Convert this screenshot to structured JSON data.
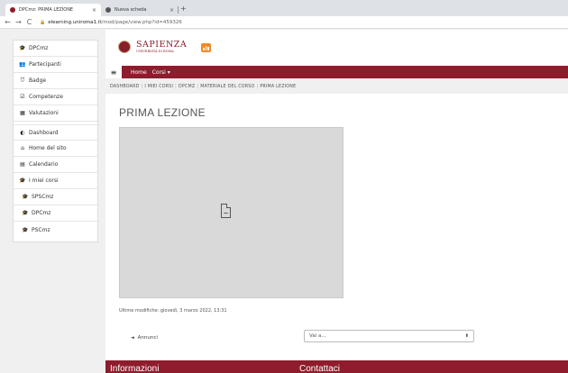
{
  "browser": {
    "tabs": [
      {
        "title": "DPCmz: PRIMA LEZIONE",
        "active": true
      },
      {
        "title": "Nuova scheda",
        "active": false
      }
    ],
    "new_tab": "+",
    "close": "×",
    "nav": {
      "back": "←",
      "forward": "→",
      "reload": "C"
    },
    "url_host": "elearning.uniroma1.it",
    "url_path": "/mod/page/view.php?id=459326"
  },
  "sidebar": {
    "items": [
      {
        "icon": "graduation-cap-icon",
        "glyph": "🎓",
        "label": "DPCmz"
      },
      {
        "icon": "users-icon",
        "glyph": "👥",
        "label": "Partecipanti"
      },
      {
        "icon": "shield-icon",
        "glyph": "⛉",
        "label": "Badge"
      },
      {
        "icon": "check-square-icon",
        "glyph": "☑",
        "label": "Competenze"
      },
      {
        "icon": "table-icon",
        "glyph": "▦",
        "label": "Valutazioni"
      },
      {
        "icon": "dashboard-icon",
        "glyph": "◐",
        "label": "Dashboard"
      },
      {
        "icon": "home-icon",
        "glyph": "⌂",
        "label": "Home del sito"
      },
      {
        "icon": "calendar-icon",
        "glyph": "▤",
        "label": "Calendario"
      },
      {
        "icon": "graduation-cap-icon",
        "glyph": "🎓",
        "label": "I miei corsi"
      },
      {
        "icon": "graduation-cap-icon",
        "glyph": "🎓",
        "label": "SPSCmz"
      },
      {
        "icon": "graduation-cap-icon",
        "glyph": "🎓",
        "label": "DPCmz"
      },
      {
        "icon": "graduation-cap-icon",
        "glyph": "🎓",
        "label": "PSCmz"
      }
    ]
  },
  "header": {
    "logo_main": "SAPIENZA",
    "logo_sub": "UNIVERSITÀ DI ROMA"
  },
  "menu": {
    "hamburger": "≡",
    "home": "Home",
    "courses": "Corsi ▾"
  },
  "breadcrumb": [
    "DASHBOARD",
    "I MIEI CORSI",
    "DPCMZ",
    "MATERIALE DEL CORSO",
    "PRIMA LEZIONE"
  ],
  "main": {
    "title": "PRIMA LEZIONE",
    "last_modified": "Ultime modifiche: giovedì, 3 marzo 2022, 13:31",
    "prev_arrow": "◄",
    "prev_label": "Annunci",
    "jump_placeholder": "Vai a...",
    "jump_caret": "⬍"
  },
  "footer": {
    "col1": "Informazioni",
    "col2": "Contattaci"
  },
  "colors": {
    "brand": "#8e1c2c",
    "badge": "#f08a24"
  }
}
